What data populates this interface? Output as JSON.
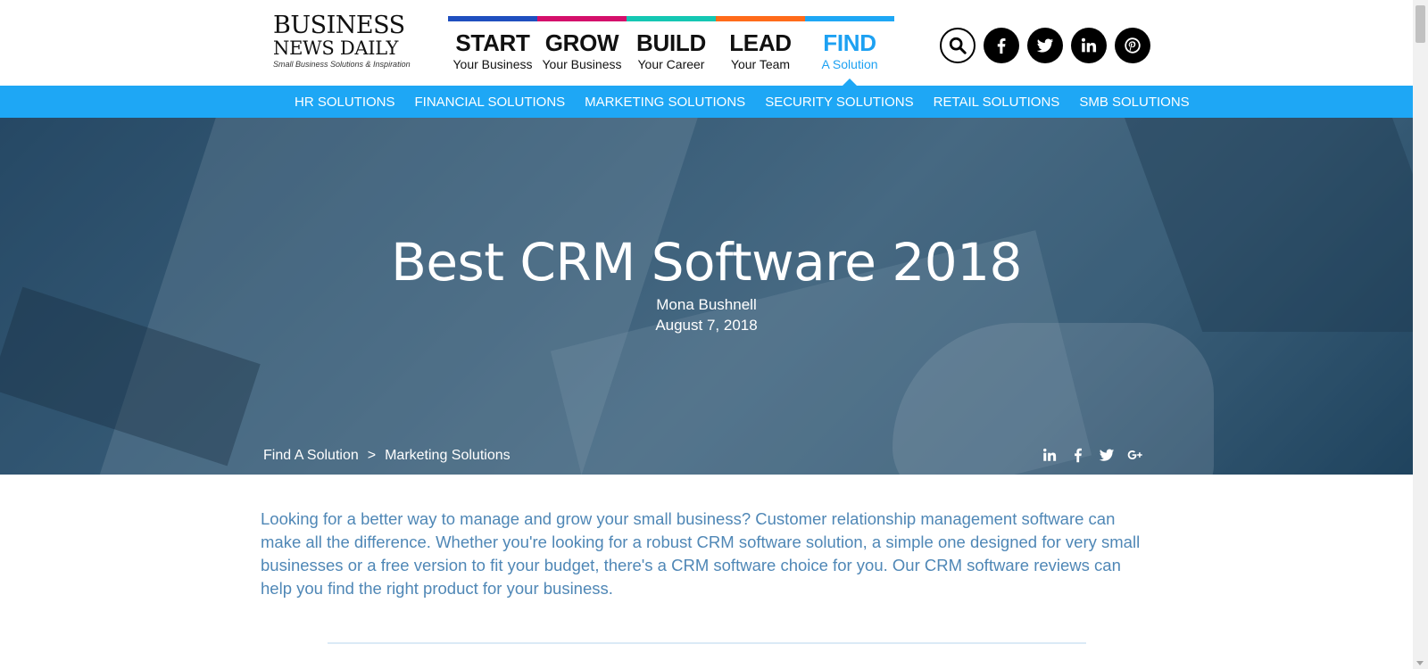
{
  "logo": {
    "line1": "BUSINESS",
    "line2": "NEWS DAILY",
    "tagline": "Small Business Solutions & Inspiration"
  },
  "nav": {
    "items": [
      {
        "main": "START",
        "sub": "Your Business",
        "color": "#1f4fbf"
      },
      {
        "main": "GROW",
        "sub": "Your Business",
        "color": "#d40f6b"
      },
      {
        "main": "BUILD",
        "sub": "Your Career",
        "color": "#14c7b3"
      },
      {
        "main": "LEAD",
        "sub": "Your Team",
        "color": "#ff6b1a"
      },
      {
        "main": "FIND",
        "sub": "A Solution",
        "color": "#1ea7f5",
        "active": true
      }
    ]
  },
  "social": {
    "icons": [
      "search-icon",
      "facebook-icon",
      "twitter-icon",
      "linkedin-icon",
      "pinterest-icon"
    ]
  },
  "subnav": {
    "items": [
      "HR SOLUTIONS",
      "FINANCIAL SOLUTIONS",
      "MARKETING SOLUTIONS",
      "SECURITY SOLUTIONS",
      "RETAIL SOLUTIONS",
      "SMB SOLUTIONS"
    ],
    "color": "#1ea7f5"
  },
  "hero": {
    "title": "Best CRM Software 2018",
    "author": "Mona Bushnell",
    "date": "August 7, 2018"
  },
  "breadcrumb": {
    "items": [
      "Find A Solution",
      "Marketing Solutions"
    ],
    "separator": ">"
  },
  "share": {
    "icons": [
      "linkedin-icon",
      "facebook-icon",
      "twitter-icon",
      "google-plus-icon"
    ]
  },
  "intro": {
    "text": "Looking for a better way to manage and grow your small business? Customer relationship management software can make all the difference. Whether you're looking for a robust CRM software solution, a simple one designed for very small businesses or a free version to fit your budget, there's a CRM software choice for you. Our CRM software reviews can help you find the right product for your business.",
    "color": "#4f87b6"
  }
}
